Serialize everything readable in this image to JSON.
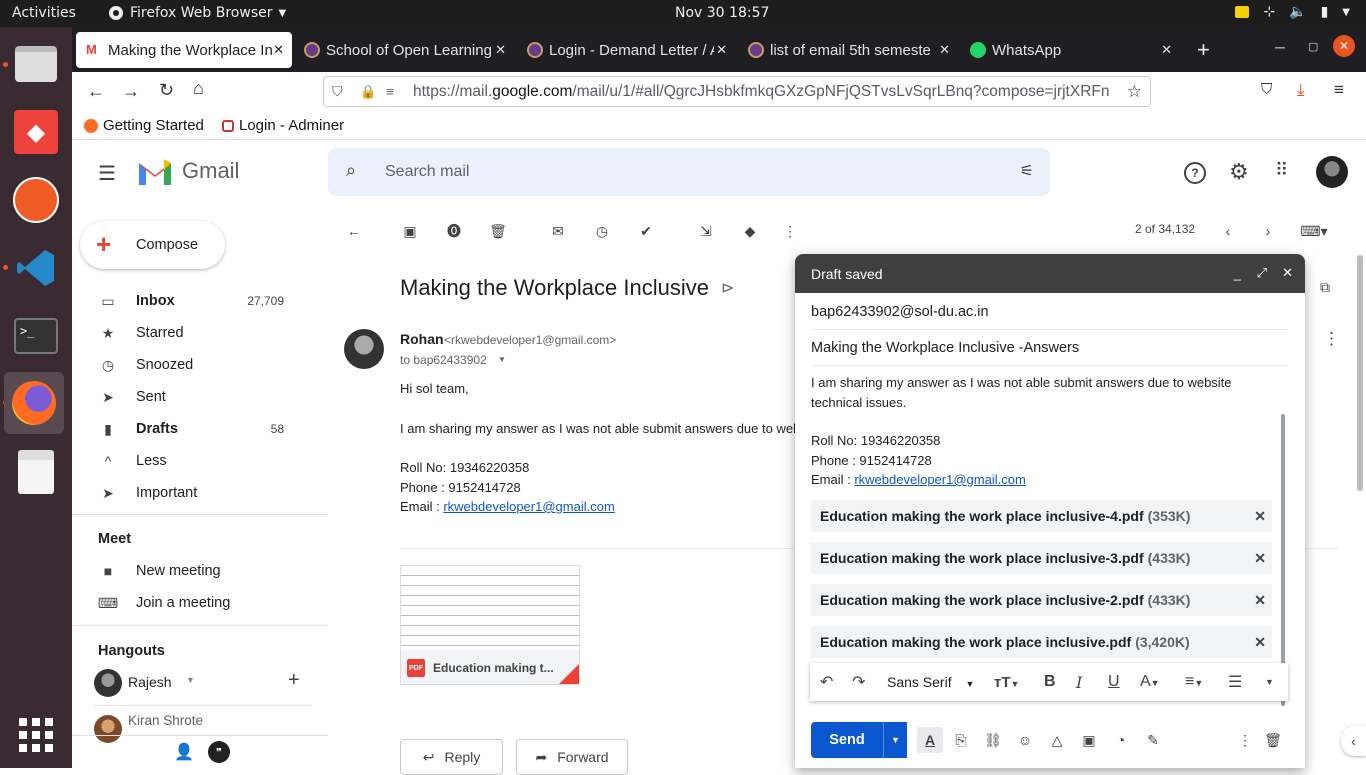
{
  "system": {
    "activities": "Activities",
    "app_name": "Firefox Web Browser",
    "clock": "Nov 30  18:57"
  },
  "browser": {
    "tabs": [
      {
        "label": "Making the Workplace In",
        "active": true
      },
      {
        "label": "School of Open Learning"
      },
      {
        "label": "Login - Demand Letter / A"
      },
      {
        "label": "list of email 5th semeste"
      },
      {
        "label": "WhatsApp"
      }
    ],
    "url_prefix": "https://mail.",
    "url_domain": "google.com",
    "url_rest": "/mail/u/1/#all/QgrcJHsbkfmkqGXzGpNFjQSTvsLvSqrLBnq?compose=jrjtXRFn",
    "bookmarks": [
      "Getting Started",
      "Login - Adminer"
    ]
  },
  "gmail": {
    "logo_text": "Gmail",
    "search_placeholder": "Search mail",
    "compose_label": "Compose",
    "nav": [
      {
        "label": "Inbox",
        "count": "27,709"
      },
      {
        "label": "Starred",
        "count": ""
      },
      {
        "label": "Snoozed",
        "count": ""
      },
      {
        "label": "Sent",
        "count": ""
      },
      {
        "label": "Drafts",
        "count": "58"
      },
      {
        "label": "Less",
        "count": ""
      },
      {
        "label": "Important",
        "count": ""
      }
    ],
    "meet": {
      "title": "Meet",
      "new_meeting": "New meeting",
      "join": "Join a meeting"
    },
    "hangouts": {
      "title": "Hangouts",
      "contact1": "Rajesh",
      "contact2": "Kiran Shrote"
    },
    "pagination": "2 of 34,132",
    "message": {
      "subject": "Making the Workplace Inclusive",
      "sender": "Rohan",
      "sender_email": "<rkwebdeveloper1@gmail.com>",
      "to": "to bap62433902",
      "greeting": "Hi sol team,",
      "line1": "I am sharing my answer as I was not able submit answers due to wel",
      "roll": "Roll No: 19346220358",
      "phone": "Phone : 9152414728",
      "email_label": "Email : ",
      "email_link": "rkwebdeveloper1@gmail.com",
      "attachment_name": "Education making t...",
      "reply": "Reply",
      "forward": "Forward"
    },
    "compose_window": {
      "title": "Draft saved",
      "to": "bap62433902@sol-du.ac.in",
      "subject": "Making the Workplace Inclusive -Answers",
      "body_line1": "I am sharing my answer as I was not able submit answers due to website",
      "body_line2": "technical issues.",
      "roll": "Roll No: 19346220358",
      "phone": "Phone : 9152414728",
      "email_label": "Email : ",
      "email_link": "rkwebdeveloper1@gmail.com",
      "attachments": [
        {
          "name": "Education making the work place inclusive-4.pdf",
          "size": "(353K)"
        },
        {
          "name": "Education making the work place inclusive-3.pdf",
          "size": "(433K)"
        },
        {
          "name": "Education making the work place inclusive-2.pdf",
          "size": "(433K)"
        },
        {
          "name": "Education making the work place inclusive.pdf",
          "size": "(3,420K)"
        }
      ],
      "font_name": "Sans Serif",
      "send_label": "Send"
    }
  }
}
